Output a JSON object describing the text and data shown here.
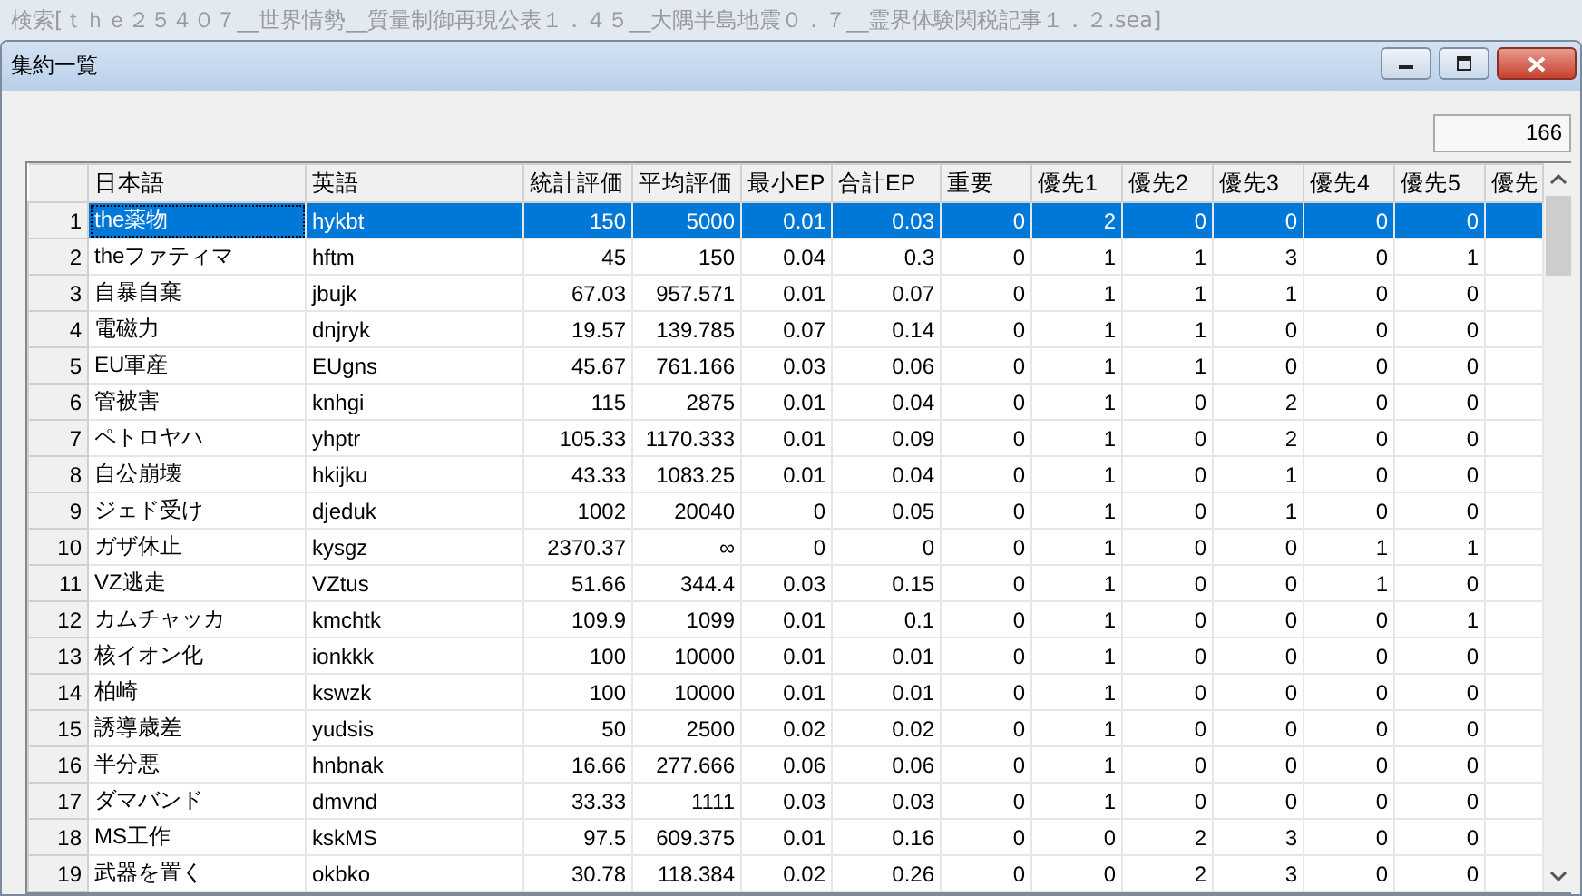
{
  "app_title": "検索[ｔｈｅ２５４０７__世界情勢__質量制御再現公表１．４５__大隅半島地震０．７__霊界体験関税記事１．２.sea]",
  "window": {
    "title": "集約一覧"
  },
  "count": "166",
  "table": {
    "columns": [
      "日本語",
      "英語",
      "統計評価",
      "平均評価",
      "最小EP",
      "合計EP",
      "重要",
      "優先1",
      "優先2",
      "優先3",
      "優先4",
      "優先5",
      "優先"
    ],
    "rows": [
      {
        "number": "1",
        "selected": true,
        "cells": [
          "the薬物",
          "hykbt",
          "150",
          "5000",
          "0.01",
          "0.03",
          "0",
          "2",
          "0",
          "0",
          "0",
          "0"
        ]
      },
      {
        "number": "2",
        "selected": false,
        "cells": [
          "theファティマ",
          "hftm",
          "45",
          "150",
          "0.04",
          "0.3",
          "0",
          "1",
          "1",
          "3",
          "0",
          "1"
        ]
      },
      {
        "number": "3",
        "selected": false,
        "cells": [
          "自暴自棄",
          "jbujk",
          "67.03",
          "957.571",
          "0.01",
          "0.07",
          "0",
          "1",
          "1",
          "1",
          "0",
          "0"
        ]
      },
      {
        "number": "4",
        "selected": false,
        "cells": [
          "電磁力",
          "dnjryk",
          "19.57",
          "139.785",
          "0.07",
          "0.14",
          "0",
          "1",
          "1",
          "0",
          "0",
          "0"
        ]
      },
      {
        "number": "5",
        "selected": false,
        "cells": [
          "EU軍産",
          "EUgns",
          "45.67",
          "761.166",
          "0.03",
          "0.06",
          "0",
          "1",
          "1",
          "0",
          "0",
          "0"
        ]
      },
      {
        "number": "6",
        "selected": false,
        "cells": [
          "管被害",
          "knhgi",
          "115",
          "2875",
          "0.01",
          "0.04",
          "0",
          "1",
          "0",
          "2",
          "0",
          "0"
        ]
      },
      {
        "number": "7",
        "selected": false,
        "cells": [
          "ペトロヤハ",
          "yhptr",
          "105.33",
          "1170.333",
          "0.01",
          "0.09",
          "0",
          "1",
          "0",
          "2",
          "0",
          "0"
        ]
      },
      {
        "number": "8",
        "selected": false,
        "cells": [
          "自公崩壊",
          "hkijku",
          "43.33",
          "1083.25",
          "0.01",
          "0.04",
          "0",
          "1",
          "0",
          "1",
          "0",
          "0"
        ]
      },
      {
        "number": "9",
        "selected": false,
        "cells": [
          "ジェド受け",
          "djeduk",
          "1002",
          "20040",
          "0",
          "0.05",
          "0",
          "1",
          "0",
          "1",
          "0",
          "0"
        ]
      },
      {
        "number": "10",
        "selected": false,
        "cells": [
          "ガザ休止",
          "kysgz",
          "2370.37",
          "∞",
          "0",
          "0",
          "0",
          "1",
          "0",
          "0",
          "1",
          "1"
        ]
      },
      {
        "number": "11",
        "selected": false,
        "cells": [
          "VZ逃走",
          "VZtus",
          "51.66",
          "344.4",
          "0.03",
          "0.15",
          "0",
          "1",
          "0",
          "0",
          "1",
          "0"
        ]
      },
      {
        "number": "12",
        "selected": false,
        "cells": [
          "カムチャッカ",
          "kmchtk",
          "109.9",
          "1099",
          "0.01",
          "0.1",
          "0",
          "1",
          "0",
          "0",
          "0",
          "1"
        ]
      },
      {
        "number": "13",
        "selected": false,
        "cells": [
          "核イオン化",
          "ionkkk",
          "100",
          "10000",
          "0.01",
          "0.01",
          "0",
          "1",
          "0",
          "0",
          "0",
          "0"
        ]
      },
      {
        "number": "14",
        "selected": false,
        "cells": [
          "柏崎",
          "kswzk",
          "100",
          "10000",
          "0.01",
          "0.01",
          "0",
          "1",
          "0",
          "0",
          "0",
          "0"
        ]
      },
      {
        "number": "15",
        "selected": false,
        "cells": [
          "誘導歳差",
          "yudsis",
          "50",
          "2500",
          "0.02",
          "0.02",
          "0",
          "1",
          "0",
          "0",
          "0",
          "0"
        ]
      },
      {
        "number": "16",
        "selected": false,
        "cells": [
          "半分悪",
          "hnbnak",
          "16.66",
          "277.666",
          "0.06",
          "0.06",
          "0",
          "1",
          "0",
          "0",
          "0",
          "0"
        ]
      },
      {
        "number": "17",
        "selected": false,
        "cells": [
          "ダマバンド",
          "dmvnd",
          "33.33",
          "1111",
          "0.03",
          "0.03",
          "0",
          "1",
          "0",
          "0",
          "0",
          "0"
        ]
      },
      {
        "number": "18",
        "selected": false,
        "cells": [
          "MS工作",
          "kskMS",
          "97.5",
          "609.375",
          "0.01",
          "0.16",
          "0",
          "0",
          "2",
          "3",
          "0",
          "0"
        ]
      },
      {
        "number": "19",
        "selected": false,
        "cells": [
          "武器を置く",
          "okbko",
          "30.78",
          "118.384",
          "0.02",
          "0.26",
          "0",
          "0",
          "2",
          "3",
          "0",
          "0"
        ]
      }
    ]
  }
}
